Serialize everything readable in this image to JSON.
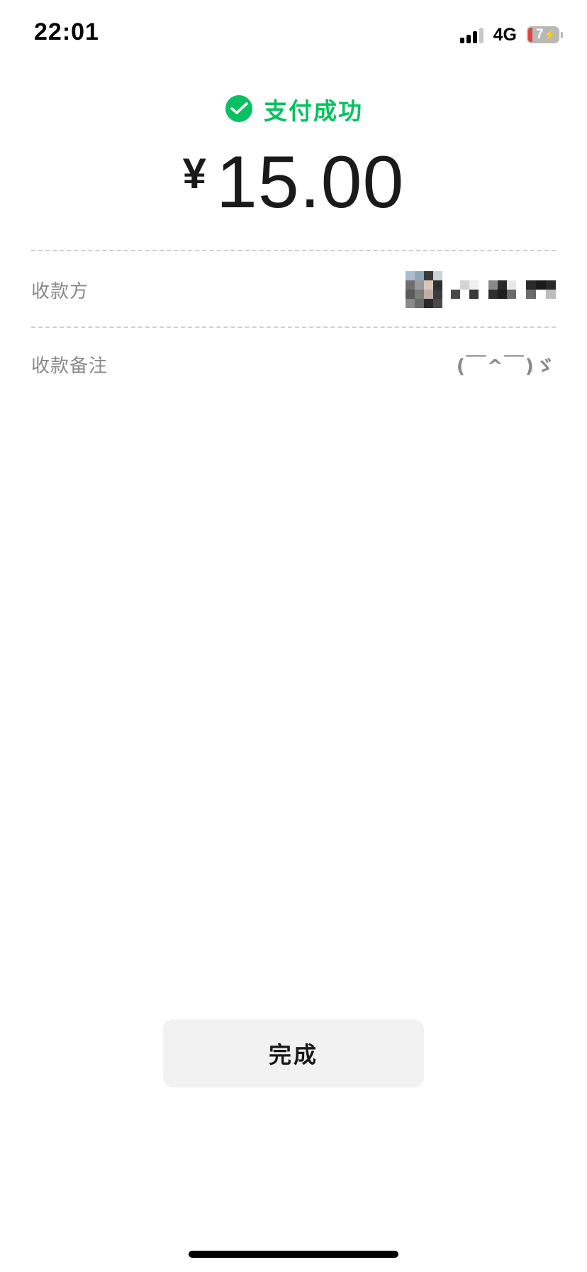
{
  "status_bar": {
    "time": "22:01",
    "network": "4G",
    "battery_percent": "7"
  },
  "header": {
    "success_text": "支付成功",
    "icon": "wechat-pay-icon",
    "accent_color": "#07c160"
  },
  "amount": {
    "currency": "¥",
    "value": "15.00"
  },
  "details": {
    "payee": {
      "label": "收款方",
      "value_obscured": true
    },
    "note": {
      "label": "收款备注",
      "value": "(￣^￣)ゞ"
    }
  },
  "actions": {
    "done_label": "完成"
  }
}
